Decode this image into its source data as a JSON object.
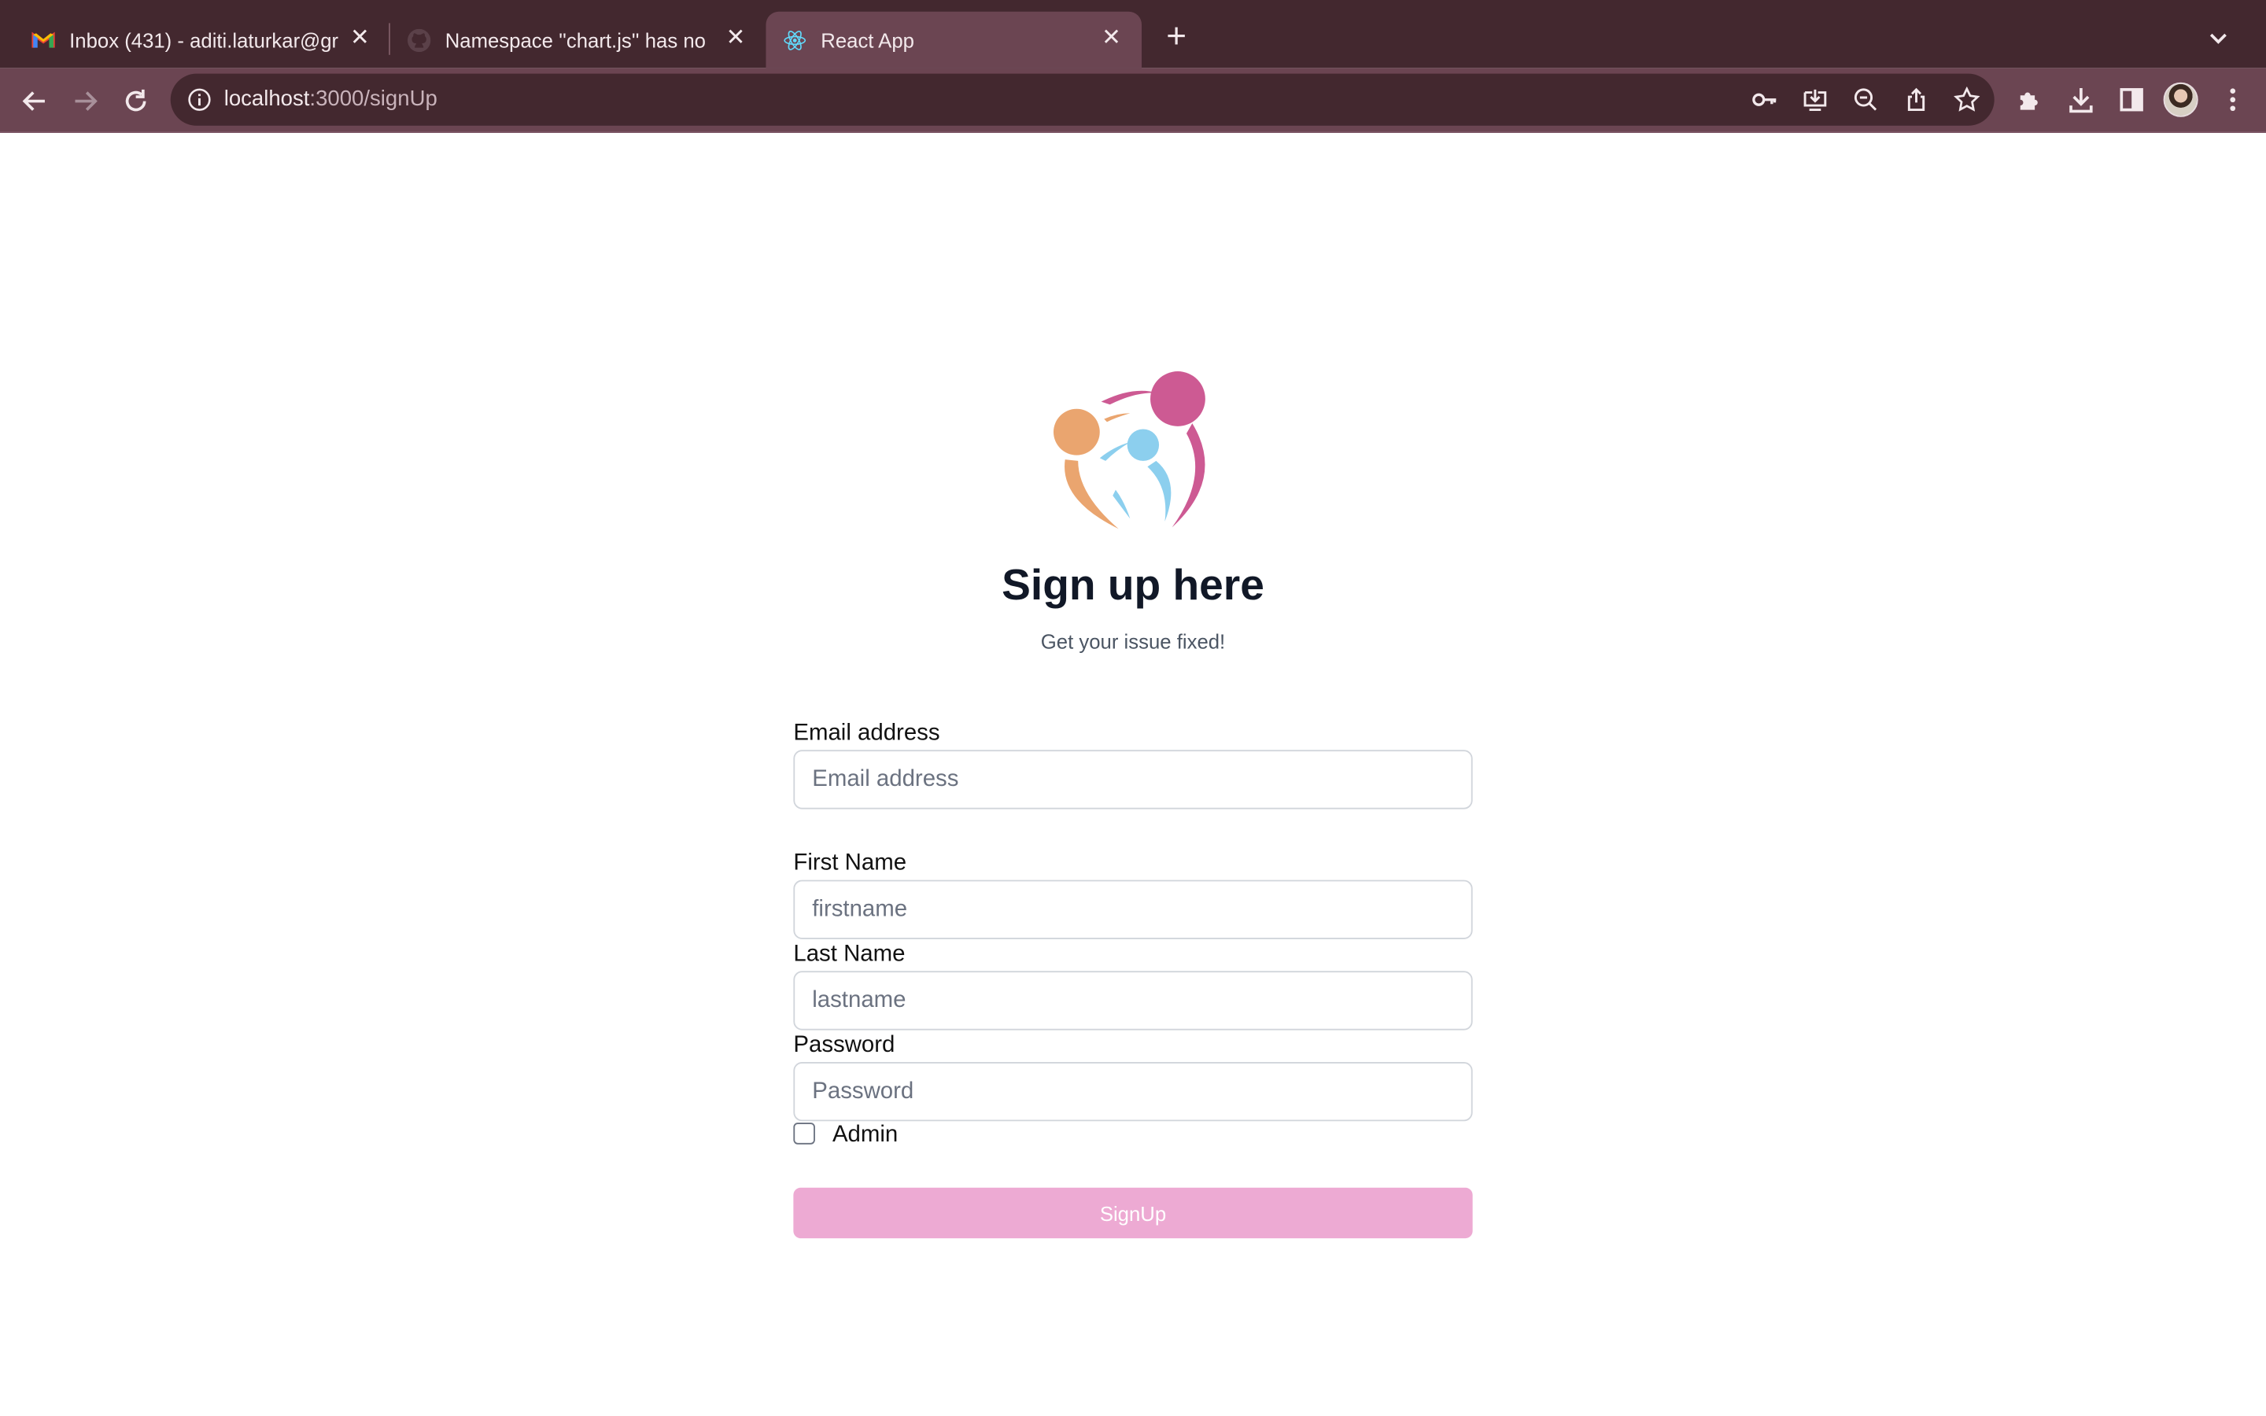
{
  "browser": {
    "tabs": [
      {
        "title": "Inbox (431) - aditi.laturkar@gr",
        "favicon": "gmail-icon"
      },
      {
        "title": "Namespace ''chart.js'' has no",
        "favicon": "github-icon"
      },
      {
        "title": "React App",
        "favicon": "react-icon",
        "active": true
      }
    ],
    "url_host": "localhost",
    "url_path": ":3000/signUp"
  },
  "page": {
    "heading": "Sign up here",
    "subheading": "Get your issue fixed!",
    "form": {
      "email_label": "Email address",
      "email_placeholder": "Email address",
      "first_name_label": "First Name",
      "first_name_placeholder": "firstname",
      "last_name_label": "Last Name",
      "last_name_placeholder": "lastname",
      "password_label": "Password",
      "password_placeholder": "Password",
      "admin_label": "Admin",
      "submit_label": "SignUp"
    }
  },
  "colors": {
    "tabstrip": "#43282f",
    "toolbar": "#6b4552",
    "accent_button": "#edaad3",
    "logo_pink": "#cd5a93",
    "logo_orange": "#eaa56f",
    "logo_blue": "#8ccfee"
  }
}
